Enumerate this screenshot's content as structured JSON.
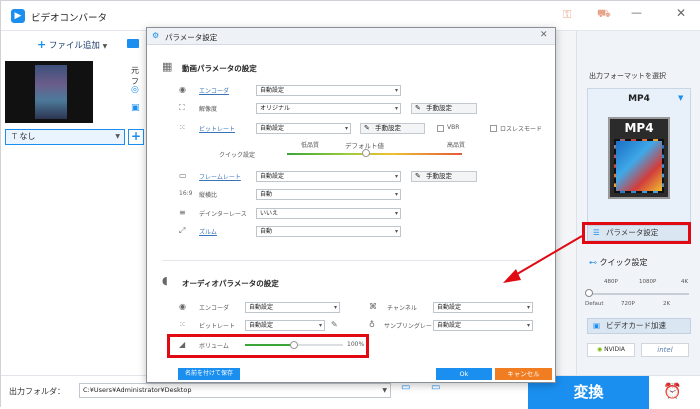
{
  "app": {
    "title": "ビデオコンバータ",
    "add_file_label": "ファイル追加",
    "file_title_prefix": "元フ",
    "subtitle_option": "なし",
    "output_folder_label": "出力フォルダ：",
    "output_folder_path": "C:¥Users¥Administrator¥Desktop",
    "convert_label": "変換"
  },
  "right_panel": {
    "output_format_label": "出力フォーマットを選択",
    "format_value": "MP4",
    "format_icon_text": "MP4",
    "param_settings_label": "パラメータ設定",
    "quick_settings_label": "クイック設定",
    "quality_ticks_top": [
      "480P",
      "1080P",
      "4K"
    ],
    "quality_ticks_bottom": [
      "Defaut",
      "720P",
      "2K"
    ],
    "gpu_accel_label": "ビデオカード加速",
    "vendor_nvidia": "NVIDIA",
    "vendor_intel": "intel"
  },
  "dialog": {
    "title": "パラメータ設定",
    "video_section": "動画パラメータの設定",
    "encoder_label": "エンコーダ",
    "encoder_value": "自動設定",
    "resolution_label": "解像度",
    "resolution_value": "オリジナル",
    "manual_label": "手動設定",
    "bitrate_label": "ビットレート",
    "bitrate_value": "自動設定",
    "vbr_label": "VBR",
    "lossless_label": "ロスレスモード",
    "quick_setting_label": "クイック設定",
    "low_quality_label": "低品質",
    "default_label": "デフォルト値",
    "high_quality_label": "高品質",
    "framerate_label": "フレームレート",
    "framerate_value": "自動設定",
    "aspect_label": "縦横比",
    "aspect_value": "自動",
    "deinterlace_label": "デインターレース",
    "deinterlace_value": "いいえ",
    "zoom_label": "ズルム",
    "zoom_value": "自動",
    "audio_section": "オーディオパラメータの設定",
    "audio_encoder_label": "エンコーダ",
    "audio_encoder_value": "自動設定",
    "channel_label": "チャンネル",
    "channel_value": "自動設定",
    "audio_bitrate_label": "ビットレート",
    "audio_bitrate_value": "自動設定",
    "samplerate_label": "サンプリングレート",
    "samplerate_value": "自動設定",
    "volume_label": "ボリューム",
    "volume_value": "100%",
    "volume_level": 0.5,
    "save_as_label": "名前を付けて保存",
    "ok_label": "Ok",
    "cancel_label": "キャンセル"
  },
  "colors": {
    "accent": "#1b8ff0",
    "highlight": "#e10a12",
    "cancel": "#f07d22",
    "nvidia": "#76b900"
  }
}
